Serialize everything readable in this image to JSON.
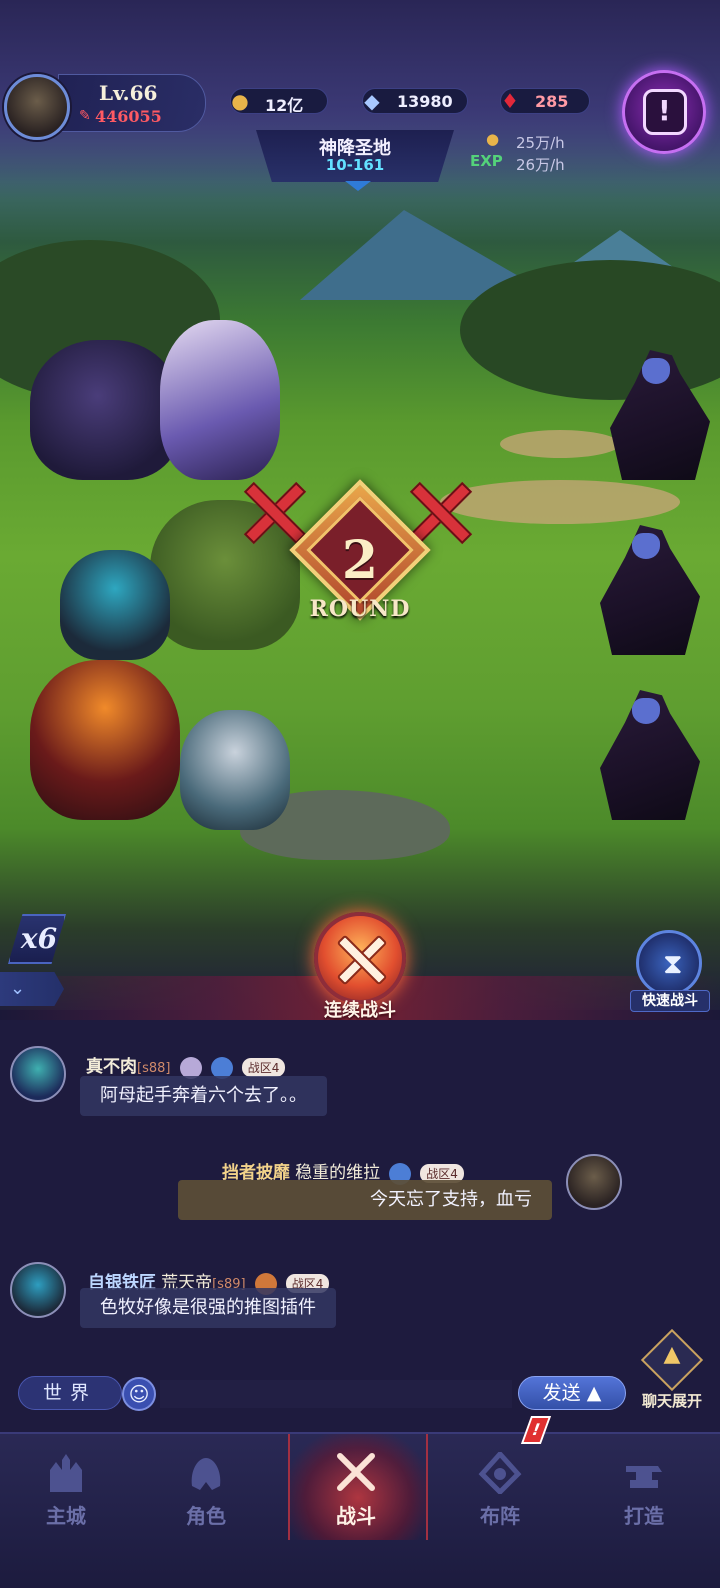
{
  "player": {
    "level": "Lv.66",
    "power": "446055"
  },
  "currencies": [
    {
      "icon": "gold-coin-icon",
      "value": "12亿"
    },
    {
      "icon": "diamond-icon",
      "value": "13980"
    },
    {
      "icon": "red-gem-icon",
      "value": "285"
    }
  ],
  "stage": {
    "name": "神降圣地",
    "number": "10-161"
  },
  "rates": {
    "gold_per_hour": "25万/h",
    "exp_label": "EXP",
    "exp_per_hour": "26万/h"
  },
  "battle": {
    "round_number": "2",
    "round_label": "ROUND",
    "speed": "x6",
    "continuous_label": "连续战斗",
    "quick_label": "快速战斗"
  },
  "chat": {
    "messages": [
      {
        "name": "真不肉",
        "server": "[s88]",
        "zone": "战区4",
        "text": "阿母起手奔着六个去了。。"
      },
      {
        "title": "挡者披靡",
        "name": "稳重的维拉",
        "zone": "战区4",
        "text": "今天忘了支持，血亏"
      },
      {
        "title": "自银铁匠",
        "name": "荒天帝",
        "server": "[s89]",
        "zone": "战区4",
        "text": "色牧好像是很强的推图插件"
      }
    ],
    "channel": "世界",
    "send_label": "发送",
    "expand_label": "聊天展开"
  },
  "nav": [
    {
      "id": "main-city",
      "label": "主城"
    },
    {
      "id": "character",
      "label": "角色"
    },
    {
      "id": "battle",
      "label": "战斗"
    },
    {
      "id": "formation",
      "label": "布阵"
    },
    {
      "id": "forge",
      "label": "打造"
    }
  ],
  "colors": {
    "grass": "#6aaa33",
    "accent_red": "#d8323a",
    "power_red": "#ff5a63",
    "stage_cyan": "#63e1ff",
    "quest_purple": "#8e2fb6"
  }
}
